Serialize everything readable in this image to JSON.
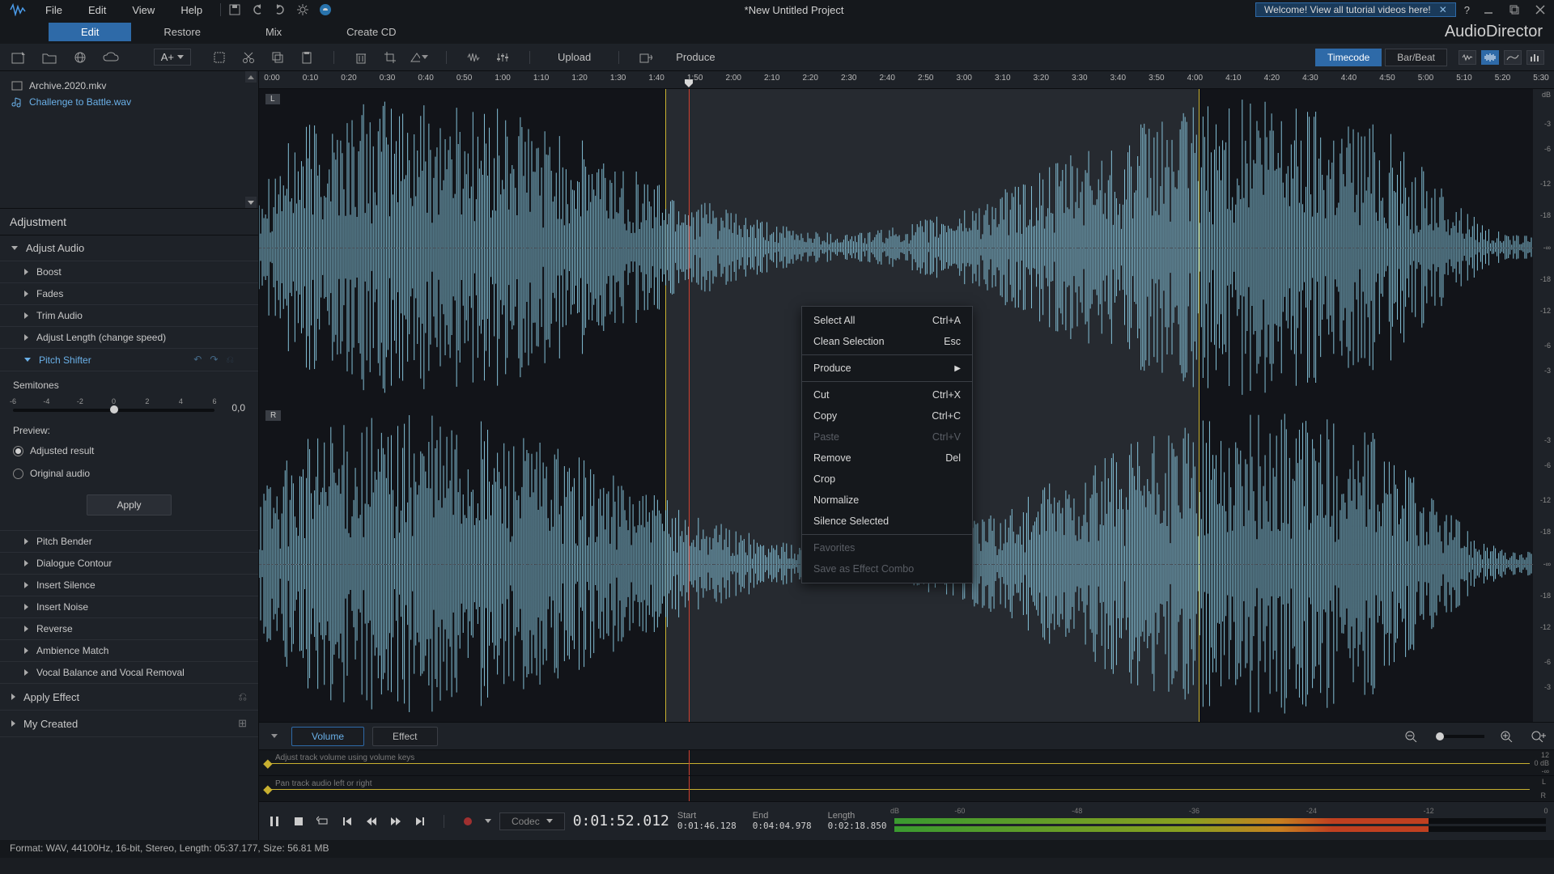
{
  "titlebar": {
    "menus": [
      "File",
      "Edit",
      "View",
      "Help"
    ],
    "project": "*New Untitled Project",
    "welcome": "Welcome! View all tutorial videos here!"
  },
  "main_tabs": {
    "items": [
      "Edit",
      "Restore",
      "Mix",
      "Create CD"
    ],
    "active": 0
  },
  "brand": "AudioDirector",
  "toolbar": {
    "upload": "Upload",
    "produce": "Produce",
    "timecode": "Timecode",
    "barbeat": "Bar/Beat"
  },
  "left_tools": {
    "a_plus": "A+"
  },
  "files": [
    {
      "name": "Archive.2020.mkv",
      "icon": "generic"
    },
    {
      "name": "Challenge to Battle.wav",
      "icon": "audio",
      "selected": true
    }
  ],
  "adjustment": {
    "title": "Adjustment",
    "adjust_audio": "Adjust Audio",
    "subs": [
      "Boost",
      "Fades",
      "Trim Audio",
      "Adjust Length (change speed)"
    ],
    "pitch_shifter": "Pitch Shifter",
    "semitones": "Semitones",
    "semitone_scale": [
      "-6",
      "-4",
      "-2",
      "0",
      "2",
      "4",
      "6"
    ],
    "semitone_value": "0,0",
    "preview": "Preview:",
    "adjusted_result": "Adjusted result",
    "original_audio": "Original audio",
    "apply": "Apply",
    "subs2": [
      "Pitch Bender",
      "Dialogue Contour",
      "Insert Silence",
      "Insert Noise",
      "Reverse",
      "Ambience Match",
      "Vocal Balance and Vocal Removal"
    ],
    "apply_effect": "Apply Effect",
    "my_created": "My Created"
  },
  "ruler": {
    "marks": [
      "0:00",
      "0:10",
      "0:20",
      "0:30",
      "0:40",
      "0:50",
      "1:00",
      "1:10",
      "1:20",
      "1:30",
      "1:40",
      "1:50",
      "2:00",
      "2:10",
      "2:20",
      "2:30",
      "2:40",
      "2:50",
      "3:00",
      "3:10",
      "3:20",
      "3:30",
      "3:40",
      "3:50",
      "4:00",
      "4:10",
      "4:20",
      "4:30",
      "4:40",
      "4:50",
      "5:00",
      "5:10",
      "5:20",
      "5:30"
    ]
  },
  "channels": {
    "L": "L",
    "R": "R"
  },
  "selection": {
    "start_pct": 31.4,
    "end_pct": 72.6
  },
  "playhead_pct": 33.2,
  "db_header": "dB",
  "db_marks": [
    "-3",
    "-6",
    "-12",
    "-18",
    "-∞",
    "-18",
    "-12",
    "-6",
    "-3"
  ],
  "context_menu": {
    "select_all": "Select All",
    "select_all_k": "Ctrl+A",
    "clean_sel": "Clean Selection",
    "clean_sel_k": "Esc",
    "produce": "Produce",
    "cut": "Cut",
    "cut_k": "Ctrl+X",
    "copy": "Copy",
    "copy_k": "Ctrl+C",
    "paste": "Paste",
    "paste_k": "Ctrl+V",
    "remove": "Remove",
    "remove_k": "Del",
    "crop": "Crop",
    "normalize": "Normalize",
    "silence": "Silence Selected",
    "favorites": "Favorites",
    "combo": "Save as Effect Combo"
  },
  "lanes": {
    "volume": "Volume",
    "effect": "Effect",
    "vol_hint": "Adjust track volume using volume keys",
    "pan_hint": "Pan track audio left or right",
    "vol_scale_top": "12",
    "vol_scale_mid": "0 dB",
    "vol_scale_bot": "-∞",
    "pan_L": "L",
    "pan_R": "R"
  },
  "transport": {
    "codec": "Codec",
    "time": "0:01:52.012",
    "start_l": "Start",
    "start_v": "0:01:46.128",
    "end_l": "End",
    "end_v": "0:04:04.978",
    "length_l": "Length",
    "length_v": "0:02:18.850"
  },
  "meter_scale": [
    "dB",
    "-60",
    "-48",
    "-36",
    "-24",
    "-12",
    "0"
  ],
  "status": "Format: WAV, 44100Hz, 16-bit, Stereo, Length: 05:37.177, Size: 56.81 MB"
}
